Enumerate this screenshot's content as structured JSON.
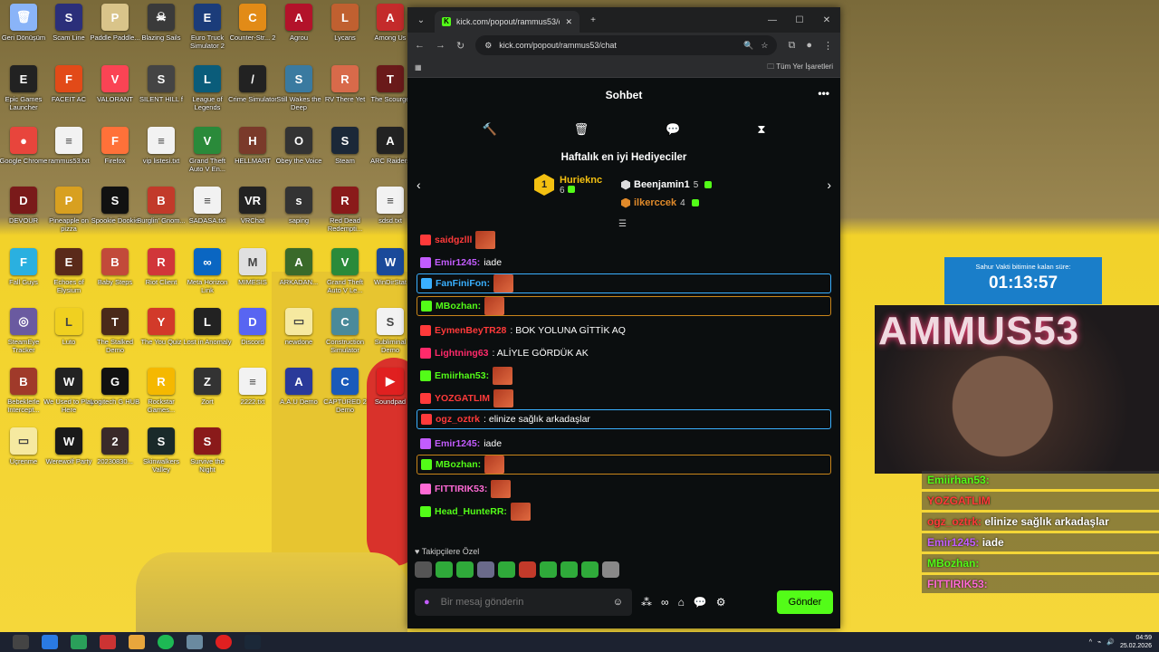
{
  "desktop": {
    "icons": [
      {
        "label": "Geri Dönüşüm",
        "color": "#8ab4f8",
        "glyph": "🗑"
      },
      {
        "label": "Scam Line",
        "color": "#2b2f7a",
        "glyph": "S"
      },
      {
        "label": "Paddle Paddle...",
        "color": "#d9c48a",
        "glyph": "P"
      },
      {
        "label": "Blazing Sails",
        "color": "#3a3a3a",
        "glyph": "☠"
      },
      {
        "label": "Euro Truck Simulator 2",
        "color": "#1b3c7a",
        "glyph": "E"
      },
      {
        "label": "Counter-Str... 2",
        "color": "#e28b17",
        "glyph": "C"
      },
      {
        "label": "Agrou",
        "color": "#b3122a",
        "glyph": "A"
      },
      {
        "label": "Lycans",
        "color": "#c06030",
        "glyph": "L"
      },
      {
        "label": "Among Us",
        "color": "#c42b2b",
        "glyph": "A"
      },
      {
        "label": "Epic Games Launcher",
        "color": "#222",
        "glyph": "E"
      },
      {
        "label": "FACEIT AC",
        "color": "#e24a18",
        "glyph": "F"
      },
      {
        "label": "VALORANT",
        "color": "#fa4454",
        "glyph": "V"
      },
      {
        "label": "SILENT HILL f",
        "color": "#444",
        "glyph": "S"
      },
      {
        "label": "League of Legends",
        "color": "#0a5c7a",
        "glyph": "L"
      },
      {
        "label": "Crime Simulator",
        "color": "#222",
        "glyph": "/"
      },
      {
        "label": "Still Wakes the Deep",
        "color": "#3a7aa0",
        "glyph": "S"
      },
      {
        "label": "RV There Yet",
        "color": "#d86a4a",
        "glyph": "R"
      },
      {
        "label": "The Scourge",
        "color": "#6a1a1a",
        "glyph": "T"
      },
      {
        "label": "Google Chrome",
        "color": "#e8453c",
        "glyph": "●"
      },
      {
        "label": "rammus53.txt",
        "color": "#f2f2f2",
        "glyph": "≡"
      },
      {
        "label": "Firefox",
        "color": "#ff7139",
        "glyph": "F"
      },
      {
        "label": "vip listesi.txt",
        "color": "#f2f2f2",
        "glyph": "≡"
      },
      {
        "label": "Grand Theft Auto V En...",
        "color": "#2a8a3a",
        "glyph": "V"
      },
      {
        "label": "HELLMART",
        "color": "#7a3a2a",
        "glyph": "H"
      },
      {
        "label": "Obey the Voice",
        "color": "#333",
        "glyph": "O"
      },
      {
        "label": "Steam",
        "color": "#1b2838",
        "glyph": "S"
      },
      {
        "label": "ARC Raiders",
        "color": "#222",
        "glyph": "A"
      },
      {
        "label": "DEVOUR",
        "color": "#7a1a1a",
        "glyph": "D"
      },
      {
        "label": "Pineapple on pizza",
        "color": "#d8a020",
        "glyph": "P"
      },
      {
        "label": "Spookie Dookie",
        "color": "#111",
        "glyph": "S"
      },
      {
        "label": "Burglin' Gnom...",
        "color": "#c23a2a",
        "glyph": "B"
      },
      {
        "label": "SADASA.txt",
        "color": "#f2f2f2",
        "glyph": "≡"
      },
      {
        "label": "VRChat",
        "color": "#222",
        "glyph": "VR"
      },
      {
        "label": "saping",
        "color": "#333",
        "glyph": "s"
      },
      {
        "label": "Red Dead Redempti...",
        "color": "#8a1a1a",
        "glyph": "R"
      },
      {
        "label": "sdsd.txt",
        "color": "#f2f2f2",
        "glyph": "≡"
      },
      {
        "label": "Fall Guys",
        "color": "#2ab0e0",
        "glyph": "F"
      },
      {
        "label": "Echoes of Elysium",
        "color": "#5a2a1a",
        "glyph": "E"
      },
      {
        "label": "Baby Steps",
        "color": "#c24a3a",
        "glyph": "B"
      },
      {
        "label": "Riot Client",
        "color": "#d13639",
        "glyph": "R"
      },
      {
        "label": "Meta Horizon Link",
        "color": "#0a66c2",
        "glyph": "∞"
      },
      {
        "label": "MIMESIS",
        "color": "#e0e0e0",
        "glyph": "M"
      },
      {
        "label": "ARKADAN...",
        "color": "#3a6a2a",
        "glyph": "A"
      },
      {
        "label": "Grand Theft Auto V Le...",
        "color": "#2a8a3a",
        "glyph": "V"
      },
      {
        "label": "WinDirStat",
        "color": "#1a4a9a",
        "glyph": "W"
      },
      {
        "label": "SteamEye Tracker",
        "color": "#6a5aa0",
        "glyph": "◎"
      },
      {
        "label": "Luto",
        "color": "#f0d020",
        "glyph": "L"
      },
      {
        "label": "The Stalked Demo",
        "color": "#4a2a1a",
        "glyph": "T"
      },
      {
        "label": "The You Quiz",
        "color": "#d23a2a",
        "glyph": "Y"
      },
      {
        "label": "Lost in Anomaly",
        "color": "#222",
        "glyph": "L"
      },
      {
        "label": "Discord",
        "color": "#5865f2",
        "glyph": "D"
      },
      {
        "label": "newdone",
        "color": "#f6e9a0",
        "glyph": "▭"
      },
      {
        "label": "Construction Simulator",
        "color": "#4a8a9a",
        "glyph": "C"
      },
      {
        "label": "Subliminal Demo",
        "color": "#f2f2f2",
        "glyph": "S"
      },
      {
        "label": "Bebeklerle Intercept...",
        "color": "#a03a2a",
        "glyph": "B"
      },
      {
        "label": "We Used to Play Here",
        "color": "#222",
        "glyph": "W"
      },
      {
        "label": "Logitech G HUB",
        "color": "#111",
        "glyph": "G"
      },
      {
        "label": "Rockstar Games...",
        "color": "#f5b800",
        "glyph": "R"
      },
      {
        "label": "Zort",
        "color": "#333",
        "glyph": "Z"
      },
      {
        "label": "2222.txt",
        "color": "#f2f2f2",
        "glyph": "≡"
      },
      {
        "label": "A.A.U Demo",
        "color": "#2a3a9a",
        "glyph": "A"
      },
      {
        "label": "CAPTURED 2 Demo",
        "color": "#1a5aba",
        "glyph": "C"
      },
      {
        "label": "Soundpad",
        "color": "#e02020",
        "glyph": "▶"
      },
      {
        "label": "Üçrenme",
        "color": "#f6e9a0",
        "glyph": "▭"
      },
      {
        "label": "Werewolf Party",
        "color": "#1a1a1a",
        "glyph": "W"
      },
      {
        "label": "20230830...",
        "color": "#3a2a2a",
        "glyph": "2"
      },
      {
        "label": "Skinwalkers Valley",
        "color": "#1a2a2a",
        "glyph": "S"
      },
      {
        "label": "Survive the Night",
        "color": "#8a1a1a",
        "glyph": "S"
      }
    ]
  },
  "browser": {
    "tab_title": "kick.com/popout/rammus53/chat",
    "url": "kick.com/popout/rammus53/chat",
    "bookmarks_all": "Tüm Yer İşaretleri"
  },
  "chat": {
    "header": "Sohbet",
    "gifters_title": "Haftalık en iyi Hediyeciler",
    "rank1_name": "Hurieknc",
    "rank1_count": "6",
    "rank2_name": "Beenjamin1",
    "rank2_count": "5",
    "rank3_name": "ilkerccek",
    "rank3_count": "4",
    "messages": [
      {
        "user": "saidgzlll",
        "user_color": "#ff3a3a",
        "text": "",
        "emote": true,
        "boxed": false
      },
      {
        "user": "Emir1245:",
        "user_color": "#c35cff",
        "text": "iade",
        "emote": false,
        "boxed": false
      },
      {
        "user": "FanFiniFon:",
        "user_color": "#3ab0ff",
        "text": "",
        "emote": true,
        "boxed": true,
        "border": "#3ab0ff"
      },
      {
        "user": "MBozhan:",
        "user_color": "#53fc18",
        "text": "",
        "emote": true,
        "boxed": true,
        "border": "#c9851a"
      },
      {
        "user": "EymenBeyTR28",
        "user_color": "#ff3a3a",
        "text": ": BOK YOLUNA GİTTİK AQ",
        "emote": false,
        "boxed": false
      },
      {
        "user": "Lightning63",
        "user_color": "#ff2a6a",
        "text": ": ALİYLE GÖRDÜK AK",
        "emote": false,
        "boxed": false
      },
      {
        "user": "Emiirhan53:",
        "user_color": "#53fc18",
        "text": "",
        "emote": true,
        "boxed": false
      },
      {
        "user": "YOZGATLIM",
        "user_color": "#ff3a3a",
        "text": "",
        "emote": true,
        "boxed": false
      },
      {
        "user": "ogz_oztrk",
        "user_color": "#ff3a3a",
        "text": ": elinize sağlık arkadaşlar",
        "emote": false,
        "boxed": true,
        "border": "#3ab0ff"
      },
      {
        "user": "Emir1245:",
        "user_color": "#c35cff",
        "text": "iade",
        "emote": false,
        "boxed": false
      },
      {
        "user": "MBozhan:",
        "user_color": "#53fc18",
        "text": "",
        "emote": true,
        "boxed": true,
        "border": "#c9851a"
      },
      {
        "user": "FITTIRIK53:",
        "user_color": "#ff6ad5",
        "text": "",
        "emote": true,
        "boxed": false
      },
      {
        "user": "Head_HunteRR:",
        "user_color": "#53fc18",
        "text": "",
        "emote": true,
        "boxed": false
      }
    ],
    "followers_only": "Takipçilere Özel",
    "input_placeholder": "Bir mesaj gönderin",
    "send_label": "Gönder"
  },
  "overlay": {
    "timer_label": "Sahur Vakti bitimine kalan süre:",
    "timer_value": "01:13:57",
    "cam_text": "AMMUS53",
    "chat": [
      {
        "user": "Emiirhan53:",
        "text": ""
      },
      {
        "user": "YOZGATLIM",
        "text": ""
      },
      {
        "user": "ogz_oztrk:",
        "text": "elinize sağlık arkadaşlar"
      },
      {
        "user": "Emir1245:",
        "text": "iade"
      },
      {
        "user": "MBozhan:",
        "text": ""
      },
      {
        "user": "FITTIRIK53:",
        "text": ""
      }
    ]
  },
  "taskbar": {
    "time": "04:59",
    "date": "25.02.2026"
  }
}
